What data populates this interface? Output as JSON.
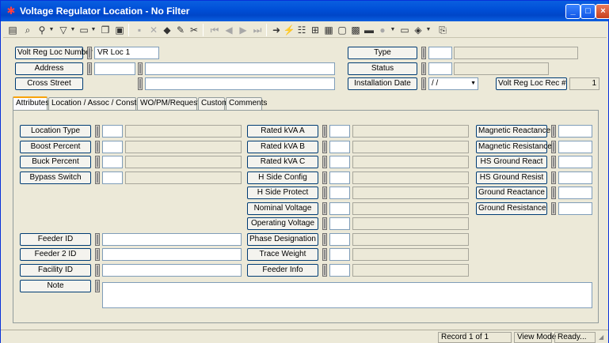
{
  "window": {
    "title": "Voltage Regulator Location - No Filter",
    "minimize": "_",
    "maximize": "□",
    "close": "×"
  },
  "header_form": {
    "volt_reg_loc_number": {
      "label": "Volt Reg Loc Number",
      "value": "VR Loc 1"
    },
    "address": {
      "label": "Address"
    },
    "cross_street": {
      "label": "Cross Street"
    },
    "type": {
      "label": "Type"
    },
    "status": {
      "label": "Status"
    },
    "installation_date": {
      "label": "Installation Date",
      "value": " / /"
    },
    "rec_num": {
      "label": "Volt Reg Loc Rec #",
      "value": "1"
    }
  },
  "tabs": [
    {
      "label": "Attributes"
    },
    {
      "label": "Location / Assoc / Construct"
    },
    {
      "label": "WO/PM/Requests"
    },
    {
      "label": "Custom"
    },
    {
      "label": "Comments"
    }
  ],
  "attributes": {
    "col1": [
      "Location Type",
      "Boost Percent",
      "Buck Percent",
      "Bypass Switch"
    ],
    "col1_lower": [
      "Feeder ID",
      "Feeder 2 ID",
      "Facility ID"
    ],
    "note": "Note",
    "col2": [
      "Rated kVA A",
      "Rated kVA B",
      "Rated kVA C",
      "H Side Config",
      "H Side Protect",
      "Nominal Voltage",
      "Operating Voltage",
      "Phase Designation",
      "Trace Weight",
      "Feeder Info"
    ],
    "col3": [
      "Magnetic Reactance",
      "Magnetic Resistance",
      "HS Ground React",
      "HS Ground Resist",
      "Ground Reactance",
      "Ground Resistance"
    ]
  },
  "statusbar": {
    "record": "Record 1 of 1",
    "mode": "View Mode",
    "state": "Ready..."
  }
}
